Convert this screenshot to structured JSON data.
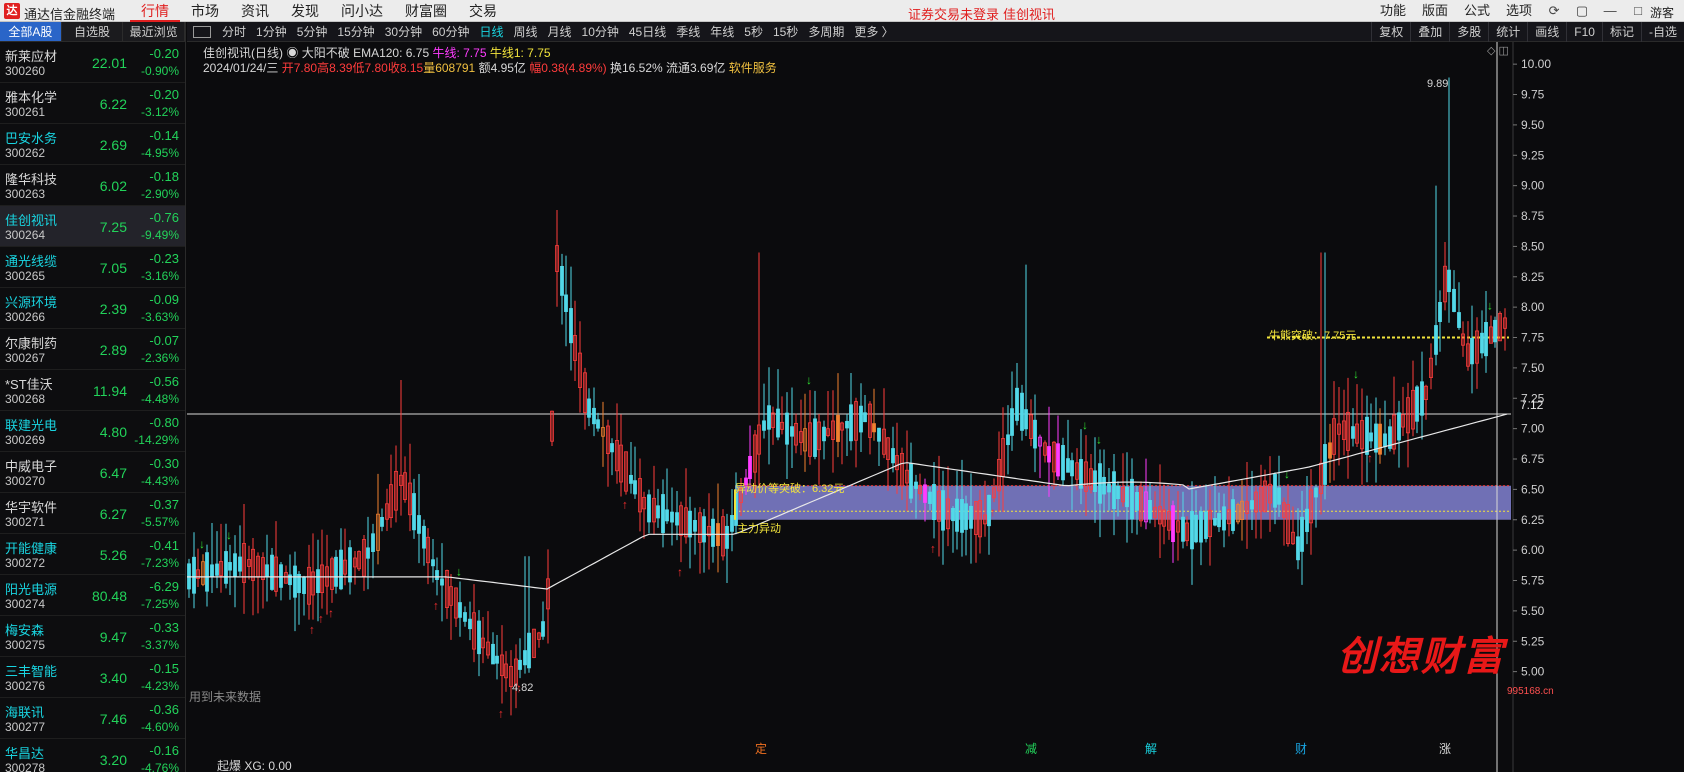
{
  "app": {
    "logo_char": "达",
    "title": "通达信金融终端",
    "menu": [
      "行情",
      "市场",
      "资讯",
      "发现",
      "问小达",
      "财富圈",
      "交易"
    ],
    "menu_active": 0,
    "login_warning": "证券交易未登录",
    "current_stock": "佳创视讯",
    "right_menu": [
      "功能",
      "版面",
      "公式",
      "选项"
    ],
    "user": "游客"
  },
  "list_tabs": [
    "全部A股",
    "自选股",
    "最近浏览"
  ],
  "stocks": [
    {
      "name": "新莱应材",
      "code": "300260",
      "price": "22.01",
      "change": "-0.20",
      "pct": "-0.90%",
      "cyan": false
    },
    {
      "name": "雅本化学",
      "code": "300261",
      "price": "6.22",
      "change": "-0.20",
      "pct": "-3.12%",
      "cyan": false
    },
    {
      "name": "巴安水务",
      "code": "300262",
      "price": "2.69",
      "change": "-0.14",
      "pct": "-4.95%",
      "cyan": true
    },
    {
      "name": "隆华科技",
      "code": "300263",
      "price": "6.02",
      "change": "-0.18",
      "pct": "-2.90%",
      "cyan": false
    },
    {
      "name": "佳创视讯",
      "code": "300264",
      "price": "7.25",
      "change": "-0.76",
      "pct": "-9.49%",
      "cyan": true
    },
    {
      "name": "通光线缆",
      "code": "300265",
      "price": "7.05",
      "change": "-0.23",
      "pct": "-3.16%",
      "cyan": true
    },
    {
      "name": "兴源环境",
      "code": "300266",
      "price": "2.39",
      "change": "-0.09",
      "pct": "-3.63%",
      "cyan": true
    },
    {
      "name": "尔康制药",
      "code": "300267",
      "price": "2.89",
      "change": "-0.07",
      "pct": "-2.36%",
      "cyan": false
    },
    {
      "name": "*ST佳沃",
      "code": "300268",
      "price": "11.94",
      "change": "-0.56",
      "pct": "-4.48%",
      "cyan": false
    },
    {
      "name": "联建光电",
      "code": "300269",
      "price": "4.80",
      "change": "-0.80",
      "pct": "-14.29%",
      "cyan": true
    },
    {
      "name": "中威电子",
      "code": "300270",
      "price": "6.47",
      "change": "-0.30",
      "pct": "-4.43%",
      "cyan": false
    },
    {
      "name": "华宇软件",
      "code": "300271",
      "price": "6.27",
      "change": "-0.37",
      "pct": "-5.57%",
      "cyan": false
    },
    {
      "name": "开能健康",
      "code": "300272",
      "price": "5.26",
      "change": "-0.41",
      "pct": "-7.23%",
      "cyan": true
    },
    {
      "name": "阳光电源",
      "code": "300274",
      "price": "80.48",
      "change": "-6.29",
      "pct": "-7.25%",
      "cyan": true
    },
    {
      "name": "梅安森",
      "code": "300275",
      "price": "9.47",
      "change": "-0.33",
      "pct": "-3.37%",
      "cyan": true
    },
    {
      "name": "三丰智能",
      "code": "300276",
      "price": "3.40",
      "change": "-0.15",
      "pct": "-4.23%",
      "cyan": true
    },
    {
      "name": "海联讯",
      "code": "300277",
      "price": "7.46",
      "change": "-0.36",
      "pct": "-4.60%",
      "cyan": true
    },
    {
      "name": "华昌达",
      "code": "300278",
      "price": "3.20",
      "change": "-0.16",
      "pct": "-4.76%",
      "cyan": true
    }
  ],
  "periods": [
    "分时",
    "1分钟",
    "5分钟",
    "15分钟",
    "30分钟",
    "60分钟",
    "日线",
    "周线",
    "月线",
    "10分钟",
    "45日线",
    "季线",
    "年线",
    "5秒",
    "15秒",
    "多周期",
    "更多 〉"
  ],
  "period_active": 6,
  "tools": [
    "复权",
    "叠加",
    "多股",
    "统计",
    "画线",
    "F10",
    "标记",
    "-自选"
  ],
  "info": {
    "title": "佳创视讯(日线)",
    "indicator": "大阳不破",
    "ema": "EMA120: 6.75",
    "niu": "牛线: 7.75",
    "niu1": "牛线1: 7.75",
    "date": "2024/01/24/三",
    "open": "开7.80",
    "high": "高8.39",
    "low": "低7.80",
    "close": "收8.15",
    "vol": "量608791",
    "amount": "额4.95亿",
    "range": "幅0.38(4.89%)",
    "turnover": "换16.52%",
    "float": "流通3.69亿",
    "sector": "软件服务"
  },
  "annotations": {
    "high_label": "9.89",
    "low_label": "4.82",
    "price_line": "7.12",
    "breakout": "异动价等突破：6.32元",
    "main_force": "主力异动",
    "niu_break": "牛熊突破：7.75元"
  },
  "future_note": "用到未来数据",
  "bottom_indicator": "起爆 XG: 0.00",
  "events": [
    {
      "label": "定",
      "color": "#f07020"
    },
    {
      "label": "减",
      "color": "#22d35a"
    },
    {
      "label": "解",
      "color": "#19d4e0"
    },
    {
      "label": "财",
      "color": "#19a4e0"
    },
    {
      "label": "涨",
      "color": "#d8d8d8"
    }
  ],
  "watermark": "创想财富",
  "watermark_url": "995168.cn",
  "colors": {
    "up": "#ff3c3c",
    "down": "#52d8e8",
    "ema": "#e8e8e8",
    "zone": "#8a8ae0",
    "niu": "#f2e43c"
  },
  "chart_data": {
    "type": "candlestick",
    "y_ticks": [
      "10.00",
      "9.75",
      "9.50",
      "9.25",
      "9.00",
      "8.75",
      "8.50",
      "8.25",
      "8.00",
      "7.75",
      "7.50",
      "7.25",
      "7.00",
      "6.75",
      "6.50",
      "6.25",
      "6.00",
      "5.75",
      "5.50",
      "5.25",
      "5.00"
    ],
    "ylim": [
      4.75,
      10.1
    ],
    "ema_label": "EMA120",
    "zone": [
      6.25,
      6.53
    ],
    "niu_level": 7.75,
    "current_price": 7.12,
    "high": 9.89,
    "low": 4.82
  }
}
